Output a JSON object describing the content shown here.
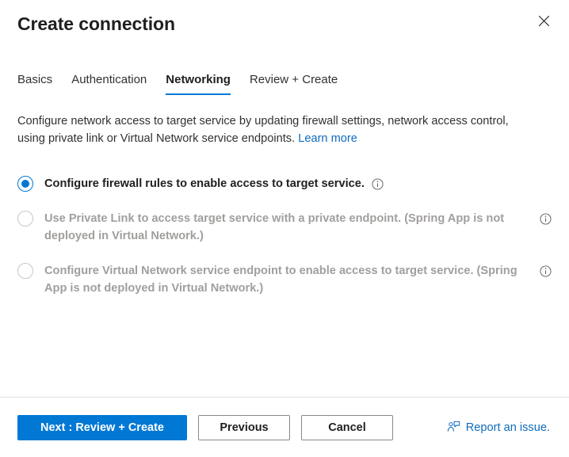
{
  "header": {
    "title": "Create connection",
    "close_icon": "close-icon"
  },
  "tabs": [
    {
      "label": "Basics",
      "selected": false
    },
    {
      "label": "Authentication",
      "selected": false
    },
    {
      "label": "Networking",
      "selected": true
    },
    {
      "label": "Review + Create",
      "selected": false
    }
  ],
  "description": {
    "text": "Configure network access to target service by updating firewall settings, network access control, using private link or Virtual Network service endpoints.",
    "link_label": "Learn more"
  },
  "options": [
    {
      "label": "Configure firewall rules to enable access to target service.",
      "checked": true,
      "disabled": false,
      "info_icon": "info-icon",
      "info_position": "inline"
    },
    {
      "label": "Use Private Link to access target service with a private endpoint. (Spring App is not deployed in Virtual Network.)",
      "checked": false,
      "disabled": true,
      "info_icon": "info-icon",
      "info_position": "trailing"
    },
    {
      "label": "Configure Virtual Network service endpoint to enable access to target service. (Spring App is not deployed in Virtual Network.)",
      "checked": false,
      "disabled": true,
      "info_icon": "info-icon",
      "info_position": "trailing"
    }
  ],
  "footer": {
    "primary_label": "Next : Review + Create",
    "previous_label": "Previous",
    "cancel_label": "Cancel",
    "report_label": "Report an issue.",
    "report_icon": "feedback-person-icon"
  },
  "colors": {
    "accent": "#0078d4",
    "link": "#0f6cbd",
    "text": "#201f1e",
    "disabled_text": "#a19f9d",
    "border": "#e1dfdd"
  }
}
